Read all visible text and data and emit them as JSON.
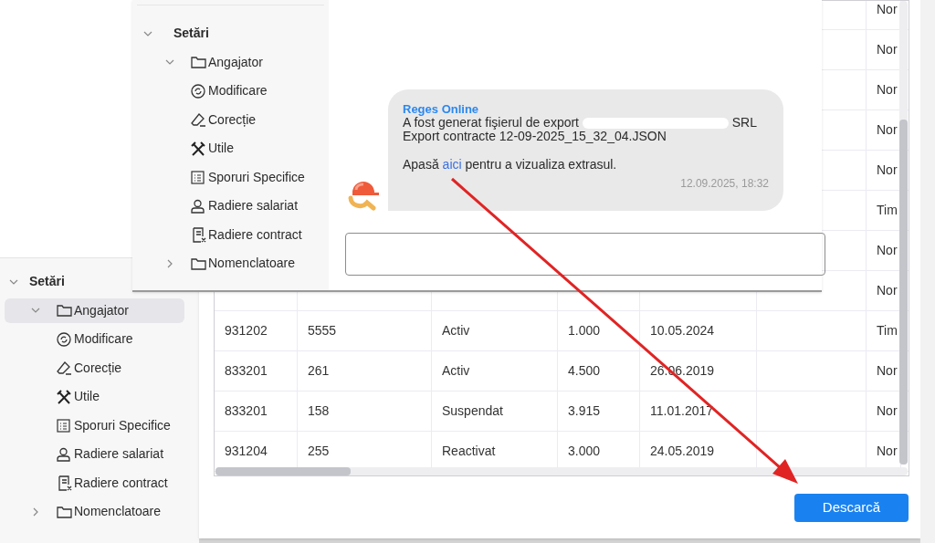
{
  "settings_popup": {
    "tree": [
      {
        "label": "Setări",
        "expanded": true,
        "selected": false,
        "children": [
          {
            "label": "Angajator",
            "kind": "folder",
            "expanded": true,
            "selected": false,
            "children": [
              {
                "label": "Modificare",
                "kind": "sync",
                "selected": false
              },
              {
                "label": "Corecție",
                "kind": "eraser",
                "selected": false
              },
              {
                "label": "Utile",
                "kind": "tools",
                "selected": false
              },
              {
                "label": "Sporuri Specifice",
                "kind": "list",
                "selected": false
              },
              {
                "label": "Radiere salariat",
                "kind": "person",
                "selected": false
              },
              {
                "label": "Radiere contract",
                "kind": "document",
                "selected": false
              }
            ]
          },
          {
            "label": "Nomenclatoare",
            "kind": "folder",
            "expanded": false,
            "selected": false
          }
        ]
      }
    ]
  },
  "chat": {
    "message": {
      "sender": "Reges Online",
      "line_1_start": "A fost generat fişierul de export",
      "line_1_end": "SRL",
      "line_2": "Export contracte 12-09-2025_15_32_04.JSON",
      "prompt_before": "Apasă",
      "link": "aici",
      "prompt_after": "pentru a vizualiza extrasul.",
      "time": "12.09.2025, 18:32"
    }
  },
  "sidebar": {
    "tree": [
      {
        "label": "Setări",
        "expanded": true,
        "selected": false,
        "children": [
          {
            "label": "Angajator",
            "kind": "folder",
            "expanded": true,
            "selected": true,
            "children": [
              {
                "label": "Modificare",
                "kind": "sync",
                "selected": false
              },
              {
                "label": "Corecție",
                "kind": "eraser",
                "selected": false
              },
              {
                "label": "Utile",
                "kind": "tools",
                "selected": false
              },
              {
                "label": "Sporuri Specifice",
                "kind": "list",
                "selected": false
              },
              {
                "label": "Radiere salariat",
                "kind": "person",
                "selected": false
              },
              {
                "label": "Radiere contract",
                "kind": "document",
                "selected": false
              }
            ]
          },
          {
            "label": "Nomenclatoare",
            "kind": "folder",
            "expanded": false,
            "selected": false
          }
        ]
      }
    ]
  },
  "table": {
    "rows": [
      {
        "column_7": "Nor"
      },
      {
        "column_7": "Nor"
      },
      {
        "column_7": "Nor"
      },
      {
        "column_7": "Nor"
      },
      {
        "column_7": "Nor"
      },
      {
        "column_7": "Tim"
      },
      {
        "column_7": "Nor"
      },
      {
        "column_7": "Nor"
      },
      {
        "column_1": "931202",
        "column_2": "5555",
        "column_3": "Activ",
        "column_4": "1.000",
        "column_5": "10.05.2024",
        "column_7": "Tim"
      },
      {
        "column_1": "833201",
        "column_2": "261",
        "column_3": "Activ",
        "column_4": "4.500",
        "column_5": "26.06.2019",
        "column_7": "Nor"
      },
      {
        "column_1": "833201",
        "column_2": "158",
        "column_3": "Suspendat",
        "column_4": "3.915",
        "column_5": "11.01.2017",
        "column_7": "Nor"
      },
      {
        "column_1": "931204",
        "column_2": "255",
        "column_3": "Reactivat",
        "column_4": "3.000",
        "column_5": "24.05.2019",
        "column_7": "Nor"
      }
    ]
  },
  "download_button": "Descarcă"
}
